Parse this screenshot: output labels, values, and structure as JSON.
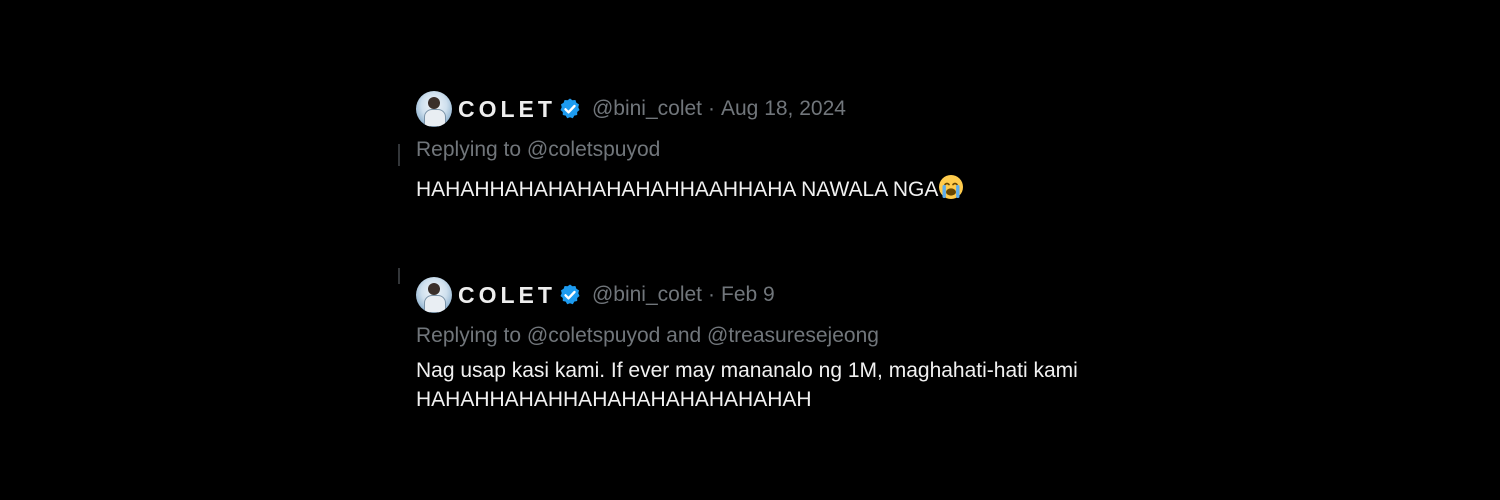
{
  "tweets": [
    {
      "avatar": "profile-avatar",
      "display_name": "COLET",
      "handle": "@bini_colet",
      "separator": "·",
      "date": "Aug 18, 2024",
      "replying_prefix": "Replying to",
      "replying_to": "@coletspuyod",
      "text": "HAHAHHAHAHAHAHAHAHHAAHHAHA NAWALA NGA",
      "emoji": "crying-face-emoji"
    },
    {
      "avatar": "profile-avatar",
      "display_name": "COLET",
      "handle": "@bini_colet",
      "separator": "·",
      "date": "Feb 9",
      "replying_prefix": "Replying to",
      "replying_to": "@coletspuyod and @treasuresejeong",
      "text_line1": "Nag usap kasi kami. If ever may mananalo ng 1M, maghahati-hati kami",
      "text_line2": "HAHAHHAHAHHAHAHAHAHAHAHAHAH"
    }
  ],
  "colors": {
    "background": "#000000",
    "text": "#e7e9ea",
    "muted": "#71767b",
    "verified": "#1d9bf0"
  }
}
